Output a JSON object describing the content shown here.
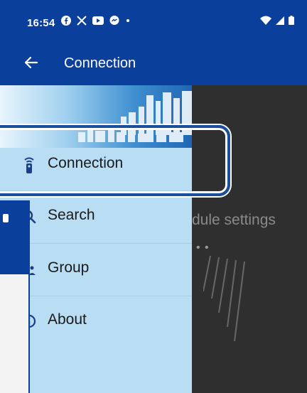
{
  "status_bar": {
    "time": "16:54",
    "left_icons": [
      "facebook-icon",
      "x-icon",
      "youtube-icon",
      "messenger-icon",
      "dot-icon"
    ],
    "right_icons": [
      "wifi-icon",
      "signal-icon",
      "battery-icon"
    ]
  },
  "app_bar": {
    "title": "Connection",
    "back_icon": "arrow-left-icon"
  },
  "drawer": {
    "header_image": "city-skyline-banner",
    "items": [
      {
        "label": "Connection",
        "icon": "remote-control-icon",
        "selected": true
      },
      {
        "label": "Search",
        "icon": "search-icon"
      },
      {
        "label": "Group",
        "icon": "group-icon"
      },
      {
        "label": "About",
        "icon": "info-circle-icon"
      }
    ]
  },
  "background_content": {
    "text": "dule settings"
  },
  "colors": {
    "primary": "#0b3f9c",
    "drawer_bg": "#b9ddf3",
    "highlight_border": "#1a4f9e",
    "scrim": "#2b2b2b"
  }
}
